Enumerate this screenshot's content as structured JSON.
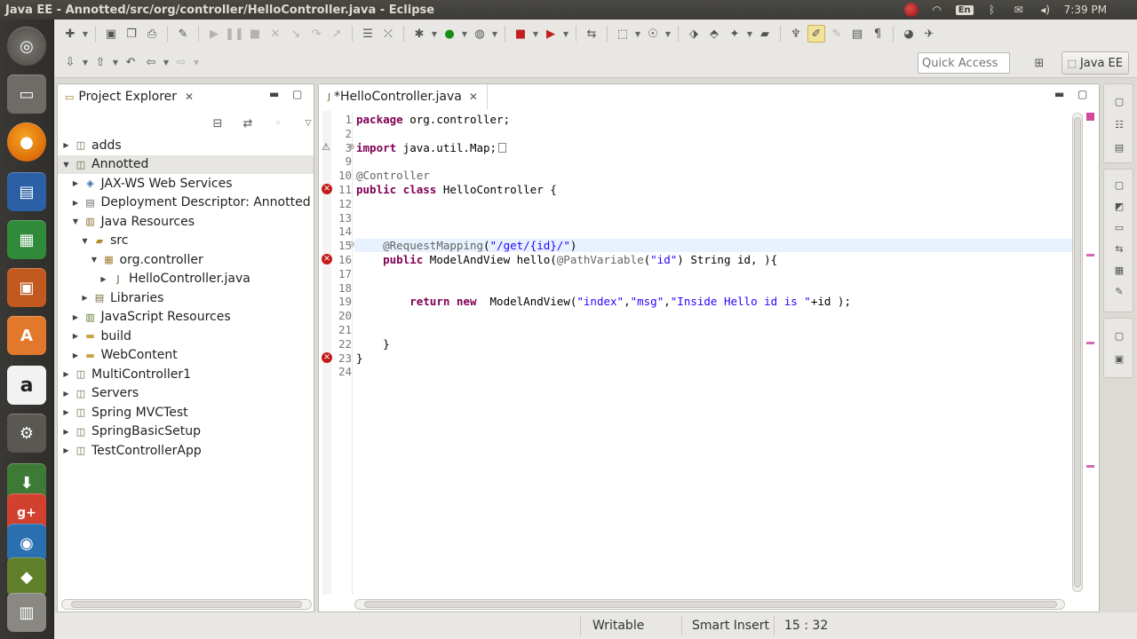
{
  "window_title": "Java EE - Annotted/src/org/controller/HelloController.java - Eclipse",
  "tray": {
    "keyboard": "En",
    "time": "7:39 PM"
  },
  "quick_access": {
    "placeholder": "Quick Access"
  },
  "perspective": {
    "label": "Java EE"
  },
  "explorer": {
    "title": "Project Explorer",
    "items": [
      {
        "label": "adds",
        "depth": 0,
        "arrow": "▶",
        "icon": "project-icon"
      },
      {
        "label": "Annotted",
        "depth": 0,
        "arrow": "▼",
        "icon": "project-icon",
        "selected": true
      },
      {
        "label": "JAX-WS Web Services",
        "depth": 1,
        "arrow": "▶",
        "icon": "web-services-icon"
      },
      {
        "label": "Deployment Descriptor: Annotted",
        "depth": 1,
        "arrow": "▶",
        "icon": "descriptor-icon"
      },
      {
        "label": "Java Resources",
        "depth": 1,
        "arrow": "▼",
        "icon": "java-resources-icon"
      },
      {
        "label": "src",
        "depth": 2,
        "arrow": "▼",
        "icon": "source-folder-icon"
      },
      {
        "label": "org.controller",
        "depth": 3,
        "arrow": "▼",
        "icon": "package-icon"
      },
      {
        "label": "HelloController.java",
        "depth": 4,
        "arrow": "▶",
        "icon": "java-file-icon"
      },
      {
        "label": "Libraries",
        "depth": 2,
        "arrow": "▶",
        "icon": "libraries-icon"
      },
      {
        "label": "JavaScript Resources",
        "depth": 1,
        "arrow": "▶",
        "icon": "js-resources-icon"
      },
      {
        "label": "build",
        "depth": 1,
        "arrow": "▶",
        "icon": "folder-icon"
      },
      {
        "label": "WebContent",
        "depth": 1,
        "arrow": "▶",
        "icon": "folder-icon"
      },
      {
        "label": "MultiController1",
        "depth": 0,
        "arrow": "▶",
        "icon": "project-icon"
      },
      {
        "label": "Servers",
        "depth": 0,
        "arrow": "▶",
        "icon": "project-icon"
      },
      {
        "label": "Spring MVCTest",
        "depth": 0,
        "arrow": "▶",
        "icon": "project-icon"
      },
      {
        "label": "SpringBasicSetup",
        "depth": 0,
        "arrow": "▶",
        "icon": "project-icon"
      },
      {
        "label": "TestControllerApp",
        "depth": 0,
        "arrow": "▶",
        "icon": "project-icon"
      }
    ]
  },
  "editor": {
    "tab_label": "*HelloController.java",
    "lines": [
      {
        "num": "1",
        "marker": "",
        "parts": [
          [
            "kw",
            "package"
          ],
          [
            "",
            " org.controller;"
          ]
        ]
      },
      {
        "num": "2",
        "marker": "",
        "parts": []
      },
      {
        "num": "3",
        "marker": "warn",
        "fold": "⊕",
        "parts": [
          [
            "kw",
            "import"
          ],
          [
            "",
            " java.util.Map;"
          ],
          [
            "box",
            ""
          ]
        ]
      },
      {
        "num": "9",
        "marker": "",
        "parts": []
      },
      {
        "num": "10",
        "marker": "",
        "parts": [
          [
            "ann",
            "@Controller"
          ]
        ]
      },
      {
        "num": "11",
        "marker": "err",
        "parts": [
          [
            "kw",
            "public class"
          ],
          [
            "",
            " HelloController {"
          ]
        ]
      },
      {
        "num": "12",
        "marker": "",
        "parts": []
      },
      {
        "num": "13",
        "marker": "",
        "parts": []
      },
      {
        "num": "14",
        "marker": "",
        "parts": []
      },
      {
        "num": "15",
        "marker": "",
        "fold": "⊖",
        "current": true,
        "parts": [
          [
            "",
            "    "
          ],
          [
            "ann",
            "@RequestMapping"
          ],
          [
            "",
            "("
          ],
          [
            "str",
            "\"/get/{id}/\""
          ],
          [
            "",
            ")"
          ]
        ]
      },
      {
        "num": "16",
        "marker": "err",
        "parts": [
          [
            "",
            "    "
          ],
          [
            "kw",
            "public"
          ],
          [
            "",
            " ModelAndView hello("
          ],
          [
            "ann",
            "@PathVariable"
          ],
          [
            "",
            "("
          ],
          [
            "str",
            "\"id\""
          ],
          [
            "",
            ") String id, ){"
          ]
        ]
      },
      {
        "num": "17",
        "marker": "",
        "parts": []
      },
      {
        "num": "18",
        "marker": "",
        "parts": []
      },
      {
        "num": "19",
        "marker": "",
        "parts": [
          [
            "",
            "        "
          ],
          [
            "kw",
            "return new"
          ],
          [
            "",
            "  ModelAndView("
          ],
          [
            "str",
            "\"index\""
          ],
          [
            "",
            ","
          ],
          [
            "str",
            "\"msg\""
          ],
          [
            "",
            ","
          ],
          [
            "str",
            "\"Inside Hello id is \""
          ],
          [
            "",
            "+id );"
          ]
        ]
      },
      {
        "num": "20",
        "marker": "",
        "parts": []
      },
      {
        "num": "21",
        "marker": "",
        "parts": []
      },
      {
        "num": "22",
        "marker": "",
        "parts": [
          [
            "",
            "    }"
          ]
        ]
      },
      {
        "num": "23",
        "marker": "err",
        "parts": [
          [
            "",
            "}"
          ]
        ]
      },
      {
        "num": "24",
        "marker": "",
        "parts": []
      }
    ]
  },
  "status": {
    "writable": "Writable",
    "insert_mode": "Smart Insert",
    "position": "15 : 32"
  },
  "colors": {
    "keyword": "#7f0055",
    "string": "#2a00ff",
    "annotation": "#646464",
    "error": "#c41c1c",
    "current_line": "#e8f2fe"
  }
}
